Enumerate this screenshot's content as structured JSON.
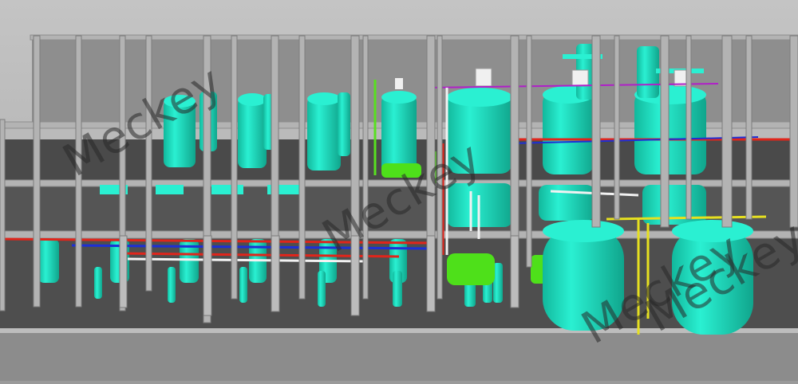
{
  "scene": {
    "subject": "3D plant layout render",
    "colors": {
      "background_sky": "#b5b5b5",
      "floor": "#4e4e4e",
      "steel_frame": "#a9a9a9",
      "vessel": "#22e8c9",
      "vessel_shade": "#12b89c",
      "pipe_red": "#e0251b",
      "pipe_blue": "#1d2fd6",
      "pipe_white": "#f2f2f2",
      "pipe_yellow": "#e6e020",
      "pipe_green": "#58e020",
      "pipe_magenta": "#b020c8"
    }
  },
  "watermarks": [
    "Meckey",
    "Meckey",
    "Meckey",
    "Meckey"
  ]
}
